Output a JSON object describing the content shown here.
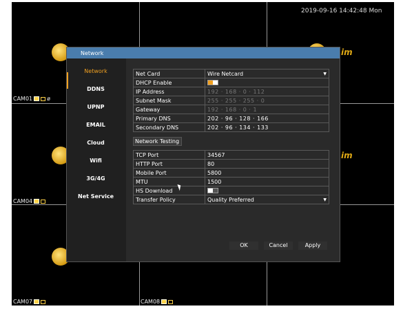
{
  "clock": "2019-09-16 14:42:48 Mon",
  "cameras": [
    {
      "label": "CAM01",
      "extra": "ø"
    },
    {
      "label": "CAM04",
      "extra": ""
    },
    {
      "label": "CAM07",
      "extra": ""
    },
    {
      "label": "CAM08",
      "extra": ""
    }
  ],
  "logo_text": "im",
  "dialog": {
    "title": "Network",
    "nav": [
      "Network",
      "DDNS",
      "UPNP",
      "EMAIL",
      "Cloud",
      "Wifi",
      "3G/4G",
      "Net Service"
    ],
    "active_nav": "Network",
    "net": {
      "net_card_label": "Net Card",
      "net_card_value": "Wire Netcard",
      "dhcp_label": "DHCP Enable",
      "dhcp_enabled": true,
      "ip_label": "IP Address",
      "ip_value": "192 · 168 ·   0   · 112",
      "mask_label": "Subnet Mask",
      "mask_value": "255 · 255 · 255 ·   0",
      "gateway_label": "Gateway",
      "gateway_value": "192 · 168 ·   0   ·   1",
      "pdns_label": "Primary DNS",
      "pdns_value": "202 ·  96  · 128 · 166",
      "sdns_label": "Secondary DNS",
      "sdns_value": "202 ·  96  · 134 · 133"
    },
    "network_testing": "Network Testing",
    "ports": {
      "tcp_label": "TCP Port",
      "tcp_value": "34567",
      "http_label": "HTTP Port",
      "http_value": "80",
      "mobile_label": "Mobile Port",
      "mobile_value": "5800",
      "mtu_label": "MTU",
      "mtu_value": "1500",
      "hs_label": "HS Download",
      "hs_enabled": false,
      "policy_label": "Transfer Policy",
      "policy_value": "Quality Preferred"
    },
    "buttons": {
      "ok": "OK",
      "cancel": "Cancel",
      "apply": "Apply"
    }
  },
  "colors": {
    "accent": "#f0a020",
    "titlebar": "#4a7dad",
    "background": "#000000"
  }
}
